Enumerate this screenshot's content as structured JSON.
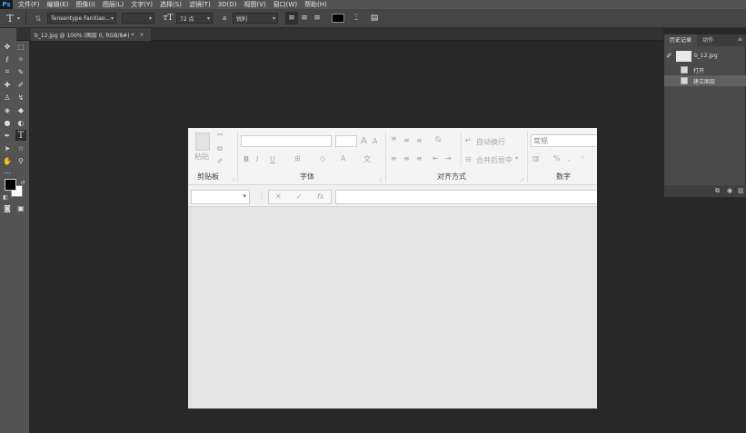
{
  "menu": {
    "logo": "Ps",
    "items": [
      "文件(F)",
      "编辑(E)",
      "图像(I)",
      "图层(L)",
      "文字(Y)",
      "选择(S)",
      "滤镜(T)",
      "3D(D)",
      "视图(V)",
      "窗口(W)",
      "帮助(H)"
    ]
  },
  "options": {
    "font_family": "Tensentype FanXiao...",
    "font_size": "72 点",
    "aa_icon": "a",
    "antialias": "锐利",
    "text_color": "#000000"
  },
  "document": {
    "tab_title": "b_12.jpg @ 100% (图层 0, RGB/8#) *",
    "close": "×"
  },
  "ribbon": {
    "paste": "粘贴",
    "clipboard": "剪贴板",
    "font": "字体",
    "alignment": "对齐方式",
    "number": "数字",
    "wrap_text": "自动换行",
    "merge_center": "合并后居中",
    "number_format": "常规",
    "bold": "B",
    "italic": "I",
    "underline": "U",
    "increase_font": "A",
    "decrease_font": "A",
    "font_color": "A",
    "wen": "文",
    "percent": "%",
    "cancel": "✕",
    "enter": "✓",
    "fx": "fx",
    "name_box_sep": "⋮"
  },
  "panel": {
    "tabs": [
      "历史记录",
      "动作"
    ],
    "menu": "≡",
    "snapshot": "b_12.jpg",
    "history": [
      "打开",
      "建立图层"
    ]
  },
  "colors": {
    "foreground": "#000000",
    "background": "#ffffff"
  }
}
